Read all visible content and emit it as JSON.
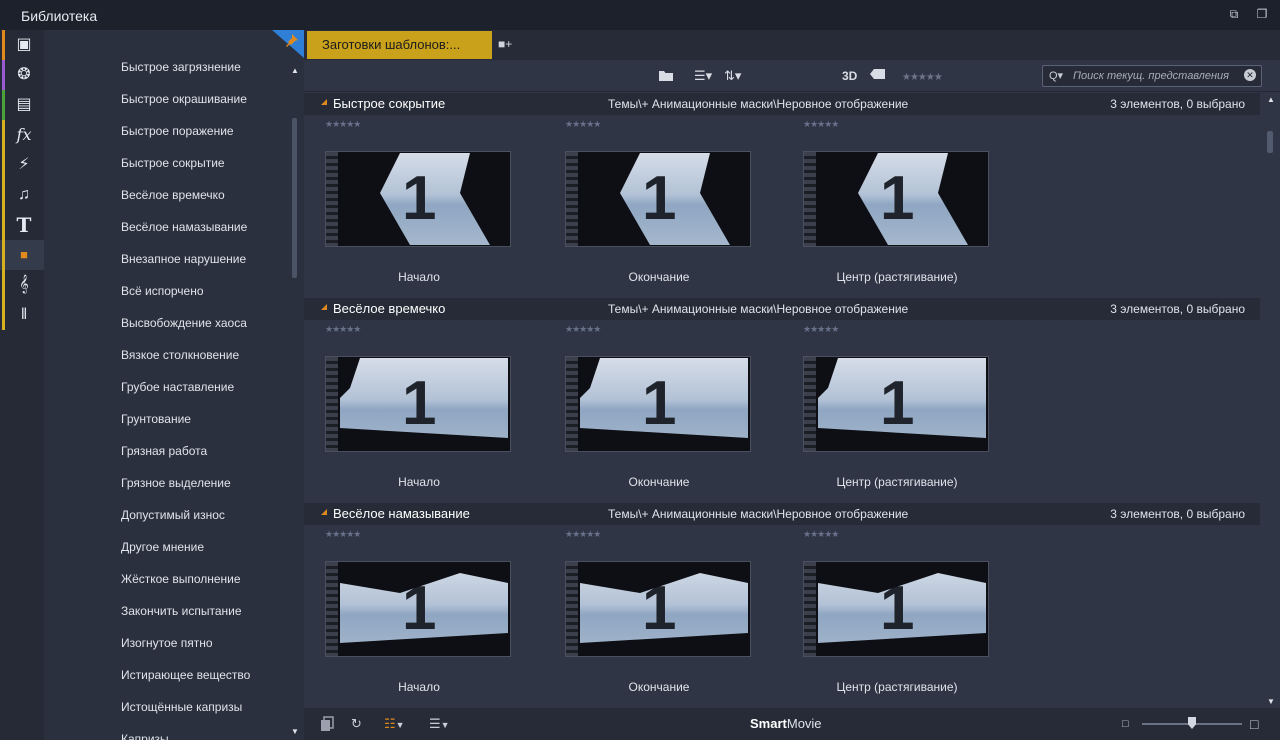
{
  "window": {
    "title": "Библиотека"
  },
  "icon_categories": [
    {
      "icon": "box-icon",
      "color": "#e0891c",
      "glyph": "▣"
    },
    {
      "icon": "film-reel-icon",
      "color": "#9b5bd0",
      "glyph": "❂"
    },
    {
      "icon": "photos-icon",
      "color": "#4aa33a",
      "glyph": "▤"
    },
    {
      "icon": "fx-icon",
      "color": "#d6b01e",
      "glyph": "fx"
    },
    {
      "icon": "lightning-icon",
      "color": "#d6b01e",
      "glyph": "⚡"
    },
    {
      "icon": "music-note-icon",
      "color": "#d6b01e",
      "glyph": "♫"
    },
    {
      "icon": "title-t-icon",
      "color": "#d6b01e",
      "glyph": "T"
    },
    {
      "icon": "montage-icon",
      "color": "#d6b01e",
      "glyph": "■"
    },
    {
      "icon": "treble-clef-icon",
      "color": "#d6b01e",
      "glyph": "𝄞"
    },
    {
      "icon": "piano-icon",
      "color": "#d6b01e",
      "glyph": "‖"
    }
  ],
  "list_items": [
    "Быстрое загрязнение",
    "Быстрое окрашивание",
    "Быстрое поражение",
    "Быстрое сокрытие",
    "Весёлое времечко",
    "Весёлое намазывание",
    "Внезапное нарушение",
    "Всё испорчено",
    "Высвобождение хаоса",
    "Вязкое столкновение",
    "Грубое наставление",
    "Грунтование",
    "Грязная работа",
    "Грязное выделение",
    "Допустимый износ",
    "Другое мнение",
    "Жёсткое выполнение",
    "Закончить испытание",
    "Изогнутое пятно",
    "Истирающее вещество",
    "Истощённые капризы",
    "Капризы"
  ],
  "tab": {
    "label": "Заготовки шаблонов:..."
  },
  "toolbar": {
    "view_3d": "3D",
    "stars": "★★★★★",
    "search_placeholder": "Поиск текущ. представления",
    "search_value": ""
  },
  "groups": [
    {
      "name": "Быстрое сокрытие",
      "path": "Темы\\+ Анимационные маски\\Неровное отображение",
      "count": "3 элементов, 0 выбрано",
      "items": [
        {
          "label": "Начало",
          "stars": "★★★★★",
          "digit": "1"
        },
        {
          "label": "Окончание",
          "stars": "★★★★★",
          "digit": "1"
        },
        {
          "label": "Центр (растягивание)",
          "stars": "★★★★★",
          "digit": "1"
        }
      ]
    },
    {
      "name": "Весёлое времечко",
      "path": "Темы\\+ Анимационные маски\\Неровное отображение",
      "count": "3 элементов, 0 выбрано",
      "items": [
        {
          "label": "Начало",
          "stars": "★★★★★",
          "digit": "1"
        },
        {
          "label": "Окончание",
          "stars": "★★★★★",
          "digit": "1"
        },
        {
          "label": "Центр (растягивание)",
          "stars": "★★★★★",
          "digit": "1"
        }
      ]
    },
    {
      "name": "Весёлое намазывание",
      "path": "Темы\\+ Анимационные маски\\Неровное отображение",
      "count": "3 элементов, 0 выбрано",
      "items": [
        {
          "label": "Начало",
          "stars": "★★★★★",
          "digit": "1"
        },
        {
          "label": "Окончание",
          "stars": "★★★★★",
          "digit": "1"
        },
        {
          "label": "Центр (растягивание)",
          "stars": "★★★★★",
          "digit": "1"
        }
      ]
    }
  ],
  "bottombar": {
    "brand_bold": "Smart",
    "brand_rest": "Movie"
  },
  "colors": {
    "accent": "#c9a11b",
    "group_triangle": "#e0891c"
  }
}
